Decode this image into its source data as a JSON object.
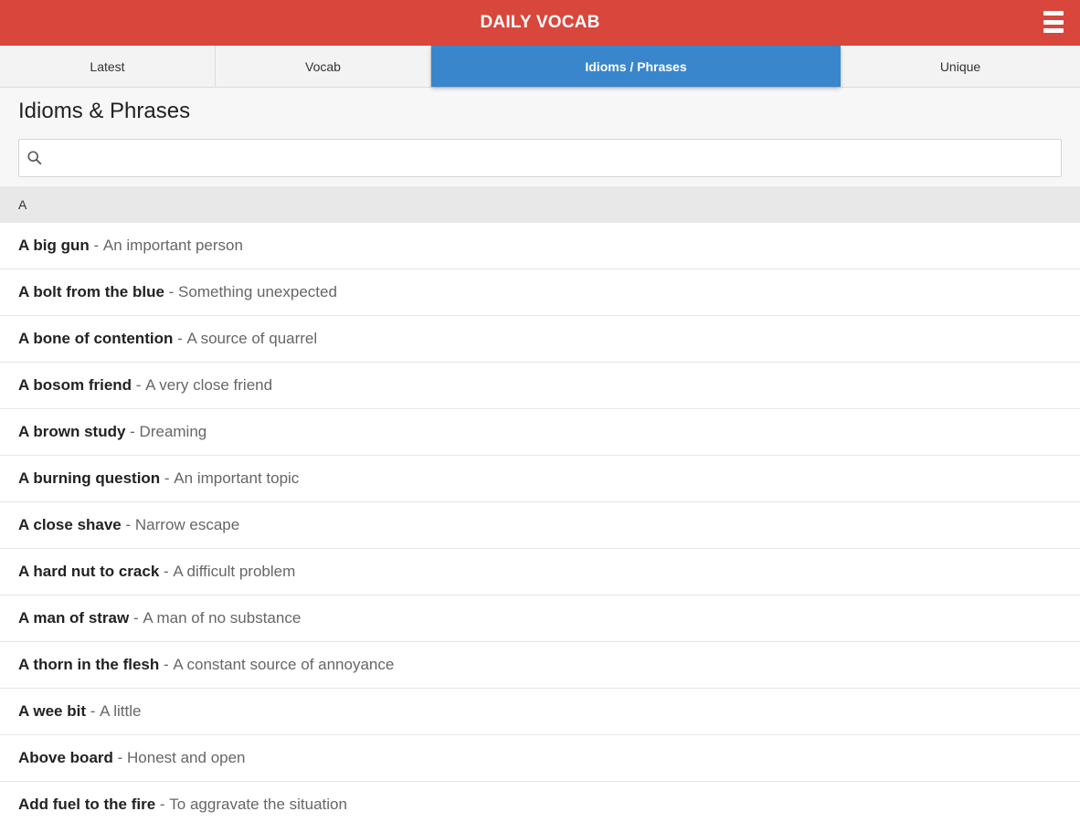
{
  "header": {
    "title": "DAILY VOCAB",
    "menu_icon": "hamburger-menu-icon"
  },
  "tabs": [
    {
      "label": "Latest",
      "active": false
    },
    {
      "label": "Vocab",
      "active": false
    },
    {
      "label": "Idioms / Phrases",
      "active": true
    },
    {
      "label": "Unique",
      "active": false
    }
  ],
  "page": {
    "title": "Idioms & Phrases",
    "search": {
      "value": "",
      "placeholder": "",
      "icon": "search-icon"
    }
  },
  "section": {
    "letter": "A"
  },
  "separator": " - ",
  "items": [
    {
      "term": "A big gun",
      "meaning": "An important person"
    },
    {
      "term": "A bolt from the blue",
      "meaning": "Something unexpected"
    },
    {
      "term": "A bone of contention",
      "meaning": "A source of quarrel"
    },
    {
      "term": "A bosom friend",
      "meaning": "A very close friend"
    },
    {
      "term": "A brown study",
      "meaning": "Dreaming"
    },
    {
      "term": "A burning question",
      "meaning": "An important topic"
    },
    {
      "term": "A close shave",
      "meaning": "Narrow escape"
    },
    {
      "term": "A hard nut to crack",
      "meaning": "A difficult problem"
    },
    {
      "term": "A man of straw",
      "meaning": "A man of no substance"
    },
    {
      "term": "A thorn in the flesh",
      "meaning": "A constant source of annoyance"
    },
    {
      "term": "A wee bit",
      "meaning": "A little"
    },
    {
      "term": "Above board",
      "meaning": "Honest and open"
    },
    {
      "term": "Add fuel to the fire",
      "meaning": "To aggravate the situation"
    }
  ],
  "colors": {
    "header": "#d9463b",
    "active_tab": "#3a86cc",
    "section_bg": "#e8e8e8"
  }
}
